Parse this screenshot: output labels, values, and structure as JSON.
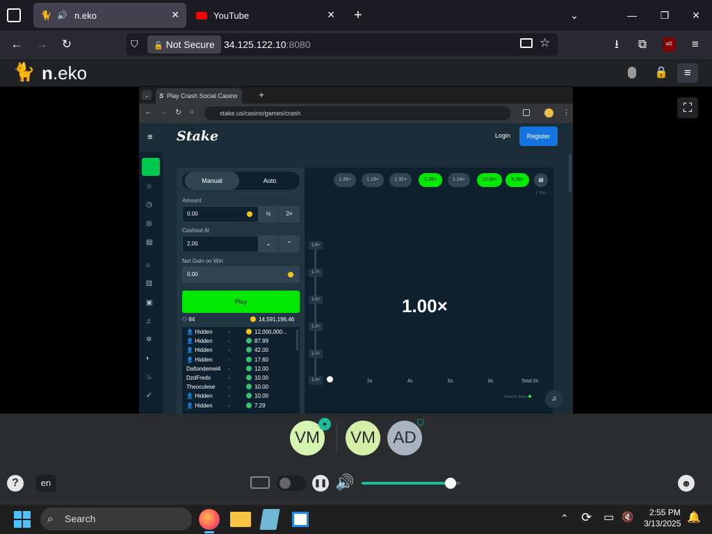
{
  "browser": {
    "tabs": [
      {
        "title": "n.eko",
        "icon": "neko-cat-icon",
        "audio": "speaker-icon",
        "active": true
      },
      {
        "title": "YouTube",
        "icon": "youtube-icon",
        "active": false
      }
    ],
    "new_tab": "+",
    "url_security": "Not Secure",
    "url_host": "34.125.122.10",
    "url_port": ":8080"
  },
  "neko": {
    "logo_bold": "n",
    "logo_rest": ".eko",
    "language": "en",
    "avatars": [
      {
        "initials": "VM",
        "color": "#d4f4b0",
        "badge": "user-host-icon"
      },
      {
        "initials": "VM",
        "color": "#d4f0a8"
      },
      {
        "initials": "AD",
        "color": "#a8b4c0",
        "badge": "shield-icon"
      }
    ],
    "volume": 0.9
  },
  "remote": {
    "tab_title": "Play Crash Social Casino",
    "url": "stake.us/casino/games/crash",
    "stake": {
      "logo": "Stake",
      "login": "Login",
      "register": "Register",
      "modes": [
        "Manual",
        "Auto"
      ],
      "amount_label": "Amount",
      "amount_value": "0.00",
      "half": "½",
      "double": "2×",
      "cashout_label": "Cashout At",
      "cashout_value": "2.00",
      "net_label": "Net Gain on Win",
      "net_value": "0.00",
      "play": "Play",
      "players": "84",
      "total": "14,591,196.46",
      "bets": [
        {
          "name": "Hidden",
          "dash": "-",
          "amount": "12,000,000...",
          "coin": "gold"
        },
        {
          "name": "Hidden",
          "dash": "-",
          "amount": "87.99",
          "coin": "green"
        },
        {
          "name": "Hidden",
          "dash": "-",
          "amount": "42.00",
          "coin": "green"
        },
        {
          "name": "Hidden",
          "dash": "-",
          "amount": "17.60",
          "coin": "green"
        },
        {
          "name": "Daltondemel4",
          "dash": "-",
          "amount": "12.00",
          "coin": "green"
        },
        {
          "name": "DzdFredo",
          "dash": "-",
          "amount": "10.00",
          "coin": "green"
        },
        {
          "name": "Theoculese",
          "dash": "-",
          "amount": "10.00",
          "coin": "green"
        },
        {
          "name": "Hidden",
          "dash": "-",
          "amount": "10.00",
          "coin": "green"
        },
        {
          "name": "Hidden",
          "dash": "-",
          "amount": "7.29",
          "coin": "green"
        }
      ],
      "history": [
        {
          "v": "1.26×",
          "hot": false
        },
        {
          "v": "1.19×",
          "hot": false
        },
        {
          "v": "1.32×",
          "hot": false
        },
        {
          "v": "2.29×",
          "hot": true
        },
        {
          "v": "1.24×",
          "hot": false
        },
        {
          "v": "13.06×",
          "hot": true
        },
        {
          "v": "5.38×",
          "hot": true
        }
      ],
      "you_label": "1 You",
      "y_ticks": [
        "1.8×",
        "1.7×",
        "1.5×",
        "1.3×",
        "1.2×",
        "1.0×"
      ],
      "x_ticks": [
        "2s",
        "4s",
        "6s",
        "8s",
        "Total 0s"
      ],
      "multiplier": "1.00×",
      "network": "Network Status"
    }
  },
  "taskbar": {
    "search": "Search",
    "time": "2:55 PM",
    "date": "3/13/2025"
  }
}
